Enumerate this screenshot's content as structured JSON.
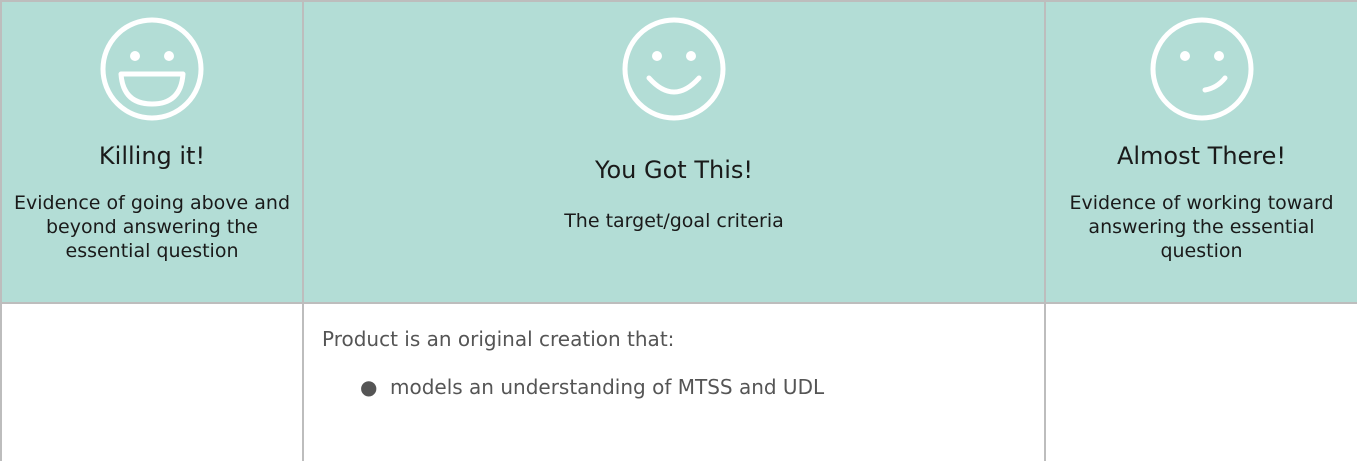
{
  "rubric": {
    "columns": [
      {
        "title": "Killing it!",
        "description": "Evidence of going above and beyond answering the essential question",
        "face": "big-grin-face-icon"
      },
      {
        "title": "You Got This!",
        "description": "The target/goal criteria",
        "face": "smile-face-icon"
      },
      {
        "title": "Almost There!",
        "description": "Evidence of working toward answering the essential question",
        "face": "smirk-face-icon"
      }
    ],
    "criteria": {
      "intro": "Product is an original creation that:",
      "bullet_symbol": "●",
      "items": [
        "models an understanding of MTSS and UDL"
      ]
    }
  },
  "colors": {
    "header_background": "#b3ddd6",
    "border": "#bdbdbd",
    "face_stroke": "#ffffff"
  }
}
